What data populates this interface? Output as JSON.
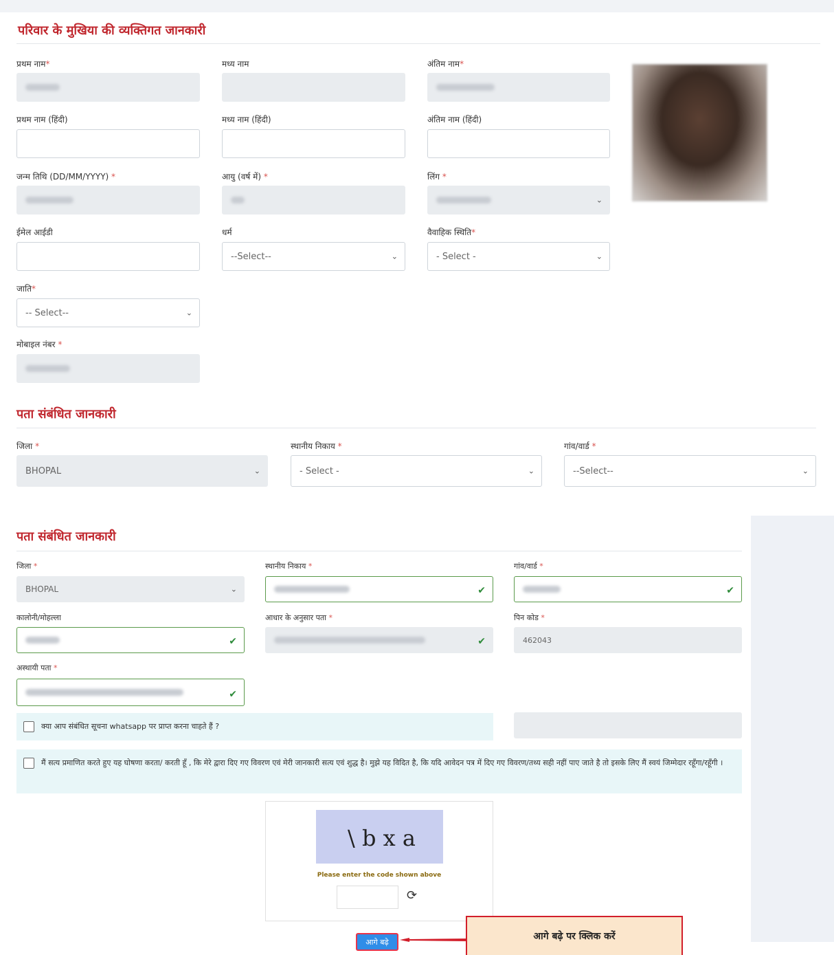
{
  "personal": {
    "title": "परिवार के मुखिया की व्यक्तिगत जानकारी",
    "first_name_label": "प्रथम नाम",
    "middle_name_label": "मध्य नाम",
    "last_name_label": "अंतिम नाम",
    "first_name_hi_label": "प्रथम नाम (हिंदी)",
    "middle_name_hi_label": "मध्य नाम (हिंदी)",
    "last_name_hi_label": "अंतिम नाम (हिंदी)",
    "dob_label": "जन्म तिथि (DD/MM/YYYY)",
    "age_label": "आयु (वर्ष में)",
    "gender_label": "लिंग",
    "email_label": "ईमेल आईडी",
    "religion_label": "धर्म",
    "religion_value": "--Select--",
    "marital_label": "वैवाहिक स्थिति",
    "marital_value": "- Select -",
    "caste_label": "जाति",
    "caste_value": "-- Select--",
    "mobile_label": "मोबाइल नंबर"
  },
  "address_top": {
    "title": "पता संबंधित जानकारी",
    "district_label": "जिला",
    "district_value": "BHOPAL",
    "local_body_label": "स्थानीय निकाय",
    "local_body_value": "- Select -",
    "ward_label": "गांव/वार्ड",
    "ward_value": "--Select--"
  },
  "address": {
    "title": "पता संबंधित जानकारी",
    "district_label": "जिला",
    "district_value": "BHOPAL",
    "local_body_label": "स्थानीय निकाय",
    "ward_label": "गांव/वार्ड",
    "colony_label": "कालोनी/मोहल्ला",
    "aadhaar_address_label": "आधार के अनुसार पता",
    "pincode_label": "पिन कोड",
    "pincode_value": "462043",
    "temp_address_label": "अस्थायी पता",
    "whatsapp_text": "क्या आप संबंधित सूचना whatsapp पर प्राप्त करना चाहते हैं ?",
    "declaration_text": "मैं सत्य प्रमाणित करते हुए यह घोषणा करता/ करती हूँ , कि मेरे द्वारा दिए गए विवरण एवं मेरी जानकारी सत्य एवं शुद्ध है। मुझे यह विदित है, कि यदि आवेदन पत्र में दिए गए विवरण/तथ्य सही नहीं पाए जाते है तो इसके लिए मैं स्वयं जिम्मेदार रहूँगा/रहूँगी ।"
  },
  "captcha": {
    "text": "\\  b x a",
    "note": "Please enter the code shown above"
  },
  "next_button": "आगे बढ़े",
  "callout": "आगे बढ़े पर क्लिक करें",
  "colors": {
    "accent_red": "#c0262d",
    "button_blue": "#2f8de8",
    "callout_bg": "#fbe6cc"
  }
}
